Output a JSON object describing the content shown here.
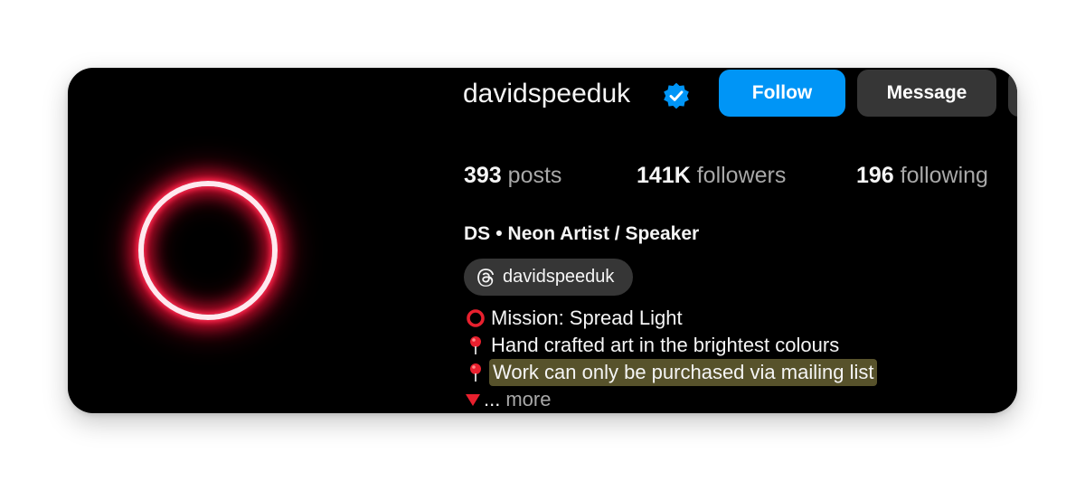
{
  "profile": {
    "username": "davidspeeduk",
    "verified_icon": "verified-badge-icon",
    "accent": "#0095f6",
    "avatar_glow": "#ff1f4b"
  },
  "actions": {
    "follow_label": "Follow",
    "message_label": "Message"
  },
  "stats": [
    {
      "num": "393",
      "label": "posts"
    },
    {
      "num": "141K",
      "label": "followers"
    },
    {
      "num": "196",
      "label": "following"
    }
  ],
  "bio": {
    "name": "DS",
    "separator": "•",
    "category": "Neon Artist / Speaker",
    "threads_handle": "davidspeeduk",
    "lines": [
      {
        "icon": "red-circle-icon",
        "text": "Mission: Spread Light"
      },
      {
        "icon": "pushpin-icon",
        "text": "Hand crafted art in the brightest colours"
      },
      {
        "icon": "pushpin-icon",
        "text": "Work can only be purchased via mailing list",
        "highlight": "#57522b"
      }
    ],
    "more_prefix": "...",
    "more_label": "more",
    "more_icon": "red-triangle-down-icon"
  }
}
